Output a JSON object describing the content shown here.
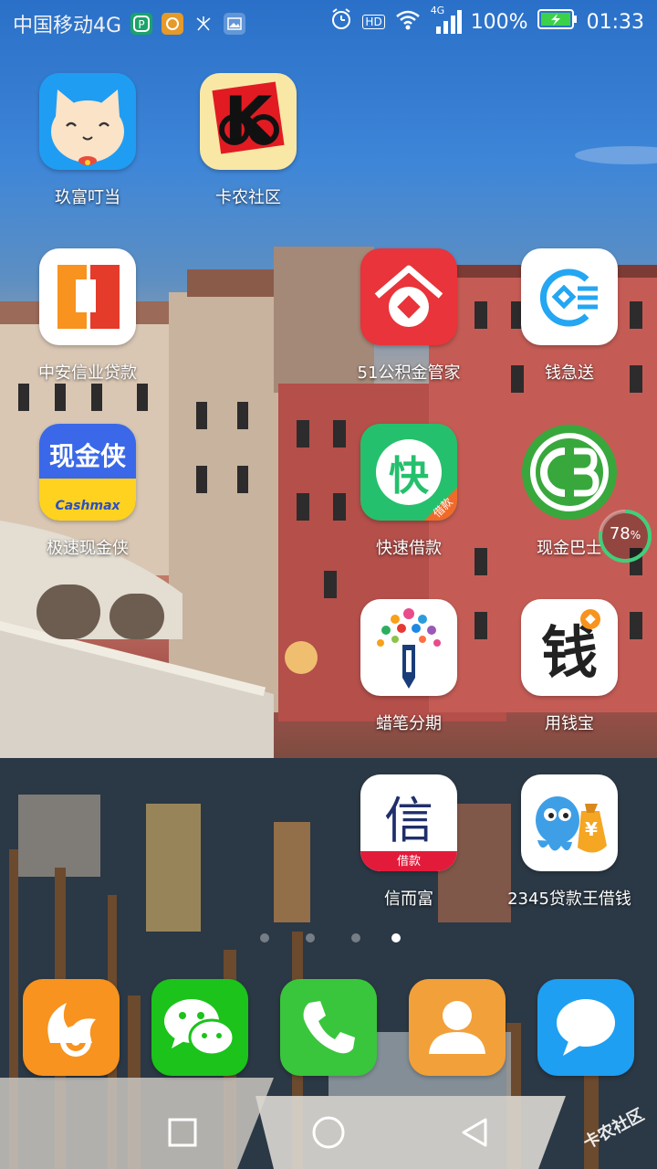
{
  "status_bar": {
    "carrier": "中国移动4G",
    "hd": "HD",
    "signal_type": "4G",
    "battery": "100%",
    "time": "01:33",
    "icons": [
      "p-app-icon",
      "uc-icon",
      "dandelion-icon",
      "gallery-icon",
      "alarm-icon",
      "wifi-icon",
      "signal-icon",
      "battery-charging-icon"
    ]
  },
  "apps": [
    {
      "label": "玖富叮当",
      "icon": "cat-face-icon",
      "color": "#1f9df3"
    },
    {
      "label": "卡农社区",
      "icon": "k-glasses-icon",
      "color": "#f9e7a6"
    },
    {
      "label": "中安信业贷款",
      "icon": "orange-square-icon",
      "color": "#ffffff"
    },
    {
      "label": "51公积金管家",
      "icon": "house-icon",
      "color": "#e8343a"
    },
    {
      "label": "钱急送",
      "icon": "blue-rounded-icon",
      "color": "#ffffff"
    },
    {
      "label": "极速现金侠",
      "icon": "cashmax-icon",
      "color": "#3a68e8"
    },
    {
      "label": "快速借款",
      "icon": "kuai-icon",
      "color": "#25c06d"
    },
    {
      "label": "现金巴士",
      "icon": "cb-circle-icon",
      "color": "#38a83c"
    },
    {
      "label": "蜡笔分期",
      "icon": "crayon-tree-icon",
      "color": "#ffffff"
    },
    {
      "label": "用钱宝",
      "icon": "qian-icon",
      "color": "#ffffff"
    },
    {
      "label": "信而富",
      "icon": "xin-icon",
      "color": "#ffffff"
    },
    {
      "label": "2345贷款王借钱",
      "icon": "octopus-icon",
      "color": "#ffffff"
    }
  ],
  "icon_text": {
    "k_letter": "K",
    "cashmax_title": "现金侠",
    "cashmax_sub": "Cashmax",
    "kuai_char": "快",
    "kuai_badge": "借款",
    "qian_char": "钱",
    "xin_char": "信",
    "xin_banner": "借款",
    "yen": "¥"
  },
  "memory_ring": {
    "value": "78",
    "unit": "%",
    "fraction": 0.78
  },
  "page_indicator": {
    "pages": 4,
    "active": 3
  },
  "dock": [
    {
      "name": "uc-browser",
      "icon": "uc-squirrel-icon",
      "color": "#f7931e"
    },
    {
      "name": "wechat",
      "icon": "wechat-bubble-icon",
      "color": "#1bc31b"
    },
    {
      "name": "phone",
      "icon": "phone-handset-icon",
      "color": "#39c63c"
    },
    {
      "name": "contacts",
      "icon": "person-icon",
      "color": "#f2a03a"
    },
    {
      "name": "messages",
      "icon": "chat-bubble-icon",
      "color": "#1e9ff2"
    }
  ],
  "watermark": "卡农社区",
  "nav": [
    "recents",
    "home",
    "back"
  ]
}
